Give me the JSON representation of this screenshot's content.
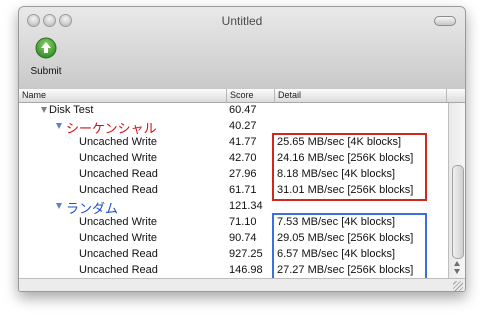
{
  "window": {
    "title": "Untitled"
  },
  "toolbar": {
    "submit_label": "Submit",
    "submit_icon": "arrow-up-circle-icon",
    "accent": "#3a9a2e"
  },
  "table": {
    "columns": [
      "Name",
      "Score",
      "Detail"
    ],
    "rows": [
      {
        "name": "Disk Test",
        "score": "60.47",
        "detail": ""
      },
      {
        "name": "シーケンシャル",
        "score": "40.27",
        "detail": ""
      },
      {
        "name": "Uncached Write",
        "score": "41.77",
        "detail": "25.65 MB/sec [4K blocks]"
      },
      {
        "name": "Uncached Write",
        "score": "42.70",
        "detail": "24.16 MB/sec [256K blocks]"
      },
      {
        "name": "Uncached Read",
        "score": "27.96",
        "detail": "8.18 MB/sec [4K blocks]"
      },
      {
        "name": "Uncached Read",
        "score": "61.71",
        "detail": "31.01 MB/sec [256K blocks]"
      },
      {
        "name": "ランダム",
        "score": "121.34",
        "detail": ""
      },
      {
        "name": "Uncached Write",
        "score": "71.10",
        "detail": "7.53 MB/sec [4K blocks]"
      },
      {
        "name": "Uncached Write",
        "score": "90.74",
        "detail": "29.05 MB/sec [256K blocks]"
      },
      {
        "name": "Uncached Read",
        "score": "927.25",
        "detail": "6.57 MB/sec [4K blocks]"
      },
      {
        "name": "Uncached Read",
        "score": "146.98",
        "detail": "27.27 MB/sec [256K blocks]"
      }
    ]
  },
  "annotation_colors": {
    "sequential_box": "#d0281f",
    "random_box": "#3c6fe0"
  }
}
